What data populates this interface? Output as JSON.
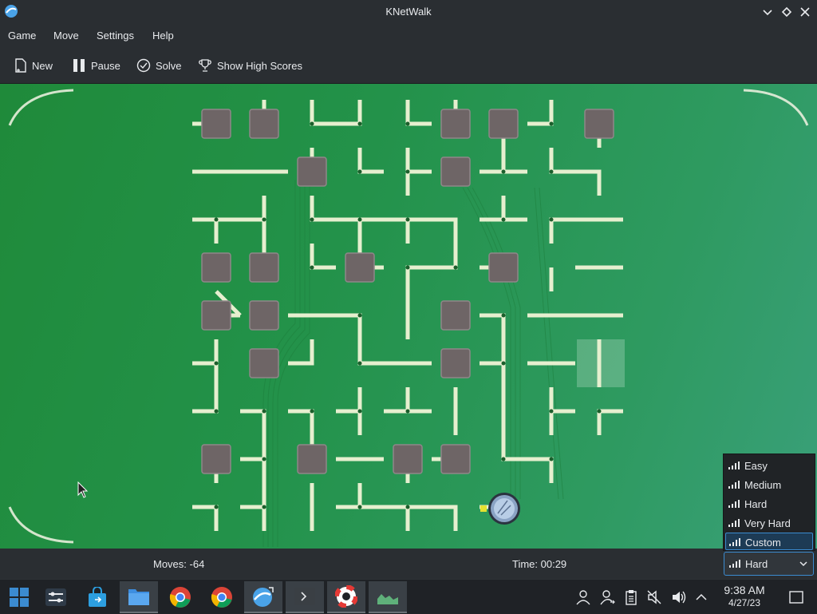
{
  "window": {
    "title": "KNetWalk"
  },
  "menu": {
    "items": [
      "Game",
      "Move",
      "Settings",
      "Help"
    ]
  },
  "toolbar": {
    "new_label": "New",
    "pause_label": "Pause",
    "solve_label": "Solve",
    "highscores_label": "Show High Scores"
  },
  "status": {
    "moves": "Moves: -64",
    "time": "Time: 00:29"
  },
  "difficulty": {
    "selected": "Hard",
    "options": [
      "Easy",
      "Medium",
      "Hard",
      "Very Hard",
      "Custom"
    ],
    "highlighted": "Custom"
  },
  "clock": {
    "time": "9:38 AM",
    "date": "4/27/23"
  },
  "taskbar": {
    "apps": [
      "start-menu",
      "system-settings",
      "discover-store",
      "file-manager",
      "chrome",
      "chrome",
      "knetwalk",
      "terminal",
      "help-center",
      "system-monitor"
    ]
  },
  "colors": {
    "board_green": "#23924a",
    "cable": "#e6efcf",
    "terminal": "#6e6566",
    "accent": "#3b8bd0"
  }
}
